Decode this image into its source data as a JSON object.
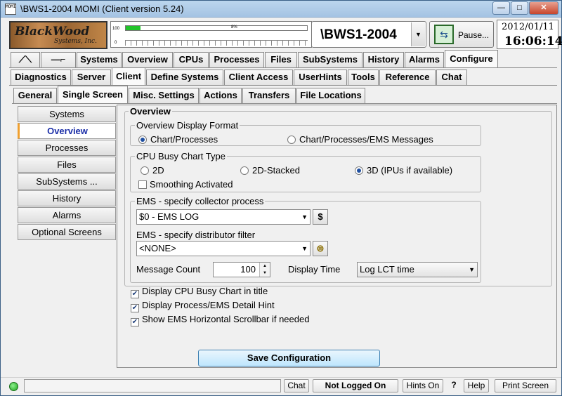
{
  "window": {
    "title": "\\BWS1-2004 MOMI (Client version 5.24)",
    "app_icon_text": "MOMI",
    "minimize": "—",
    "maximize": "□",
    "close": "✕"
  },
  "header": {
    "logo_line1": "BlackWood",
    "logo_line2": "Systems, Inc.",
    "cpu_label_top": "100",
    "cpu_label_bottom": "0",
    "cpu_percent_text": "8%",
    "cpu_percent_value": 8,
    "system_name": "\\BWS1-2004",
    "pause_label": "Pause...",
    "date": "2012/01/11",
    "time": "16:06:14"
  },
  "main_tabs": [
    "Systems",
    "Overview",
    "CPUs",
    "Processes",
    "Files",
    "SubSystems",
    "History",
    "Alarms",
    "Configure"
  ],
  "main_tab_active": "Configure",
  "config_tabs": [
    "Diagnostics",
    "Server",
    "Client",
    "Define Systems",
    "Client Access",
    "UserHints",
    "Tools",
    "Reference",
    "Chat"
  ],
  "config_tab_active": "Client",
  "client_tabs": [
    "General",
    "Single Screen",
    "Misc. Settings",
    "Actions",
    "Transfers",
    "File Locations"
  ],
  "client_tab_active": "Single Screen",
  "left_nav": [
    "Systems",
    "Overview",
    "Processes",
    "Files",
    "SubSystems ...",
    "History",
    "Alarms",
    "Optional Screens"
  ],
  "left_nav_active": "Overview",
  "panel": {
    "title": "Overview",
    "display_format": {
      "title": "Overview Display Format",
      "opt1": "Chart/Processes",
      "opt2": "Chart/Processes/EMS Messages",
      "selected": "Chart/Processes"
    },
    "cpu_chart": {
      "title": "CPU Busy Chart Type",
      "opt1": "2D",
      "opt2": "2D-Stacked",
      "opt3": "3D (IPUs if available)",
      "selected": "3D (IPUs if available)",
      "smoothing_label": "Smoothing Activated",
      "smoothing_checked": false
    },
    "ems": {
      "collector_title": "EMS - specify collector process",
      "collector_value": "$0 - EMS LOG",
      "collector_icon": "$",
      "distributor_label": "EMS - specify distributor filter",
      "distributor_value": "<NONE>",
      "message_count_label": "Message Count",
      "message_count_value": "100",
      "display_time_label": "Display Time",
      "display_time_value": "Log LCT time"
    },
    "checks": [
      {
        "label": "Display CPU Busy Chart in title",
        "checked": true
      },
      {
        "label": "Display Process/EMS Detail Hint",
        "checked": true
      },
      {
        "label": "Show EMS Horizontal Scrollbar if needed",
        "checked": true
      }
    ],
    "save_label": "Save Configuration"
  },
  "statusbar": {
    "chat": "Chat",
    "login": "Not Logged On",
    "hints": "Hints On",
    "question": "?",
    "help": "Help",
    "print": "Print Screen"
  }
}
